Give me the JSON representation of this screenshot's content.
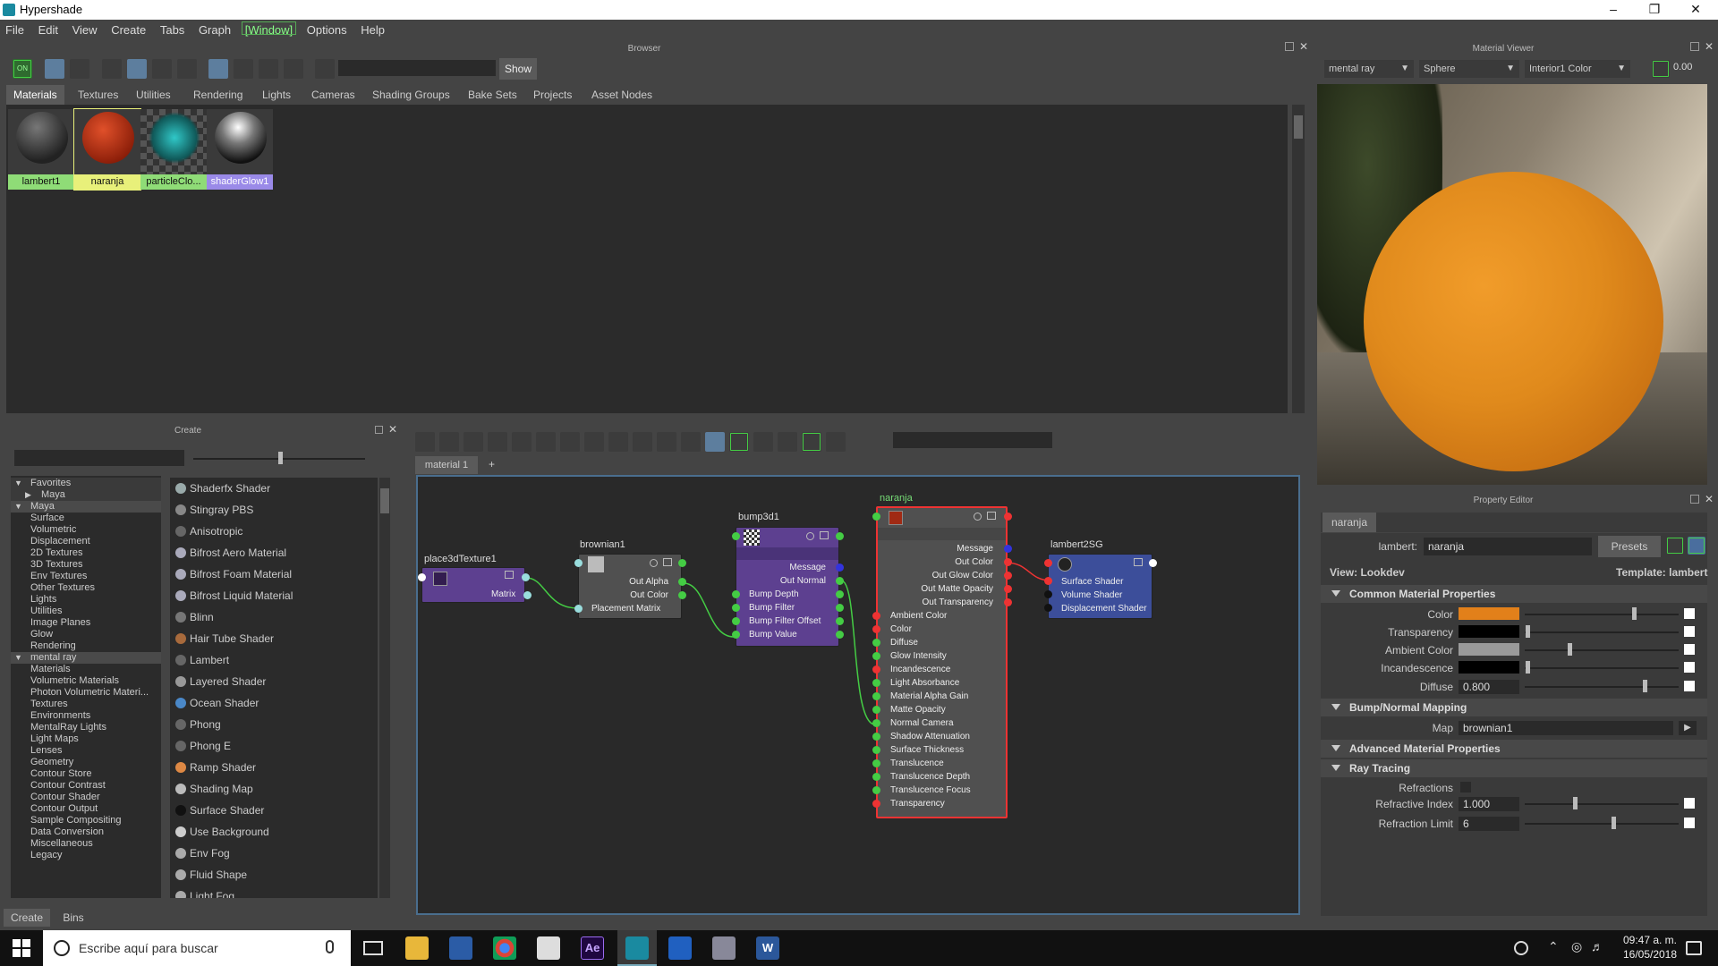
{
  "window": {
    "title": "Hypershade"
  },
  "menu": [
    "File",
    "Edit",
    "View",
    "Create",
    "Tabs",
    "Graph",
    "[Window]",
    "Options",
    "Help"
  ],
  "browser": {
    "panel_title": "Browser",
    "show_button": "Show",
    "toolbar_first": "ON",
    "tabs": [
      "Materials",
      "Textures",
      "Utilities",
      "Rendering",
      "Lights",
      "Cameras",
      "Shading Groups",
      "Bake Sets",
      "Projects",
      "Asset Nodes"
    ],
    "active_tab": "Materials",
    "swatches": [
      {
        "label": "lambert1"
      },
      {
        "label": "naranja"
      },
      {
        "label": "particleClo..."
      },
      {
        "label": "shaderGlow1"
      }
    ]
  },
  "material_viewer": {
    "panel_title": "Material Viewer",
    "renderer": "mental ray",
    "geometry": "Sphere",
    "environment": "Interior1 Color",
    "exposure": "0.00"
  },
  "create_panel": {
    "panel_title": "Create",
    "tree": [
      "Favorites",
      "Maya",
      "Maya",
      "Surface",
      "Volumetric",
      "Displacement",
      "2D Textures",
      "3D Textures",
      "Env Textures",
      "Other Textures",
      "Lights",
      "Utilities",
      "Image Planes",
      "Glow",
      "Rendering",
      "mental ray",
      "Materials",
      "Volumetric Materials",
      "Photon Volumetric Materi...",
      "Textures",
      "Environments",
      "MentalRay Lights",
      "Light Maps",
      "Lenses",
      "Geometry",
      "Contour Store",
      "Contour Contrast",
      "Contour Shader",
      "Contour Output",
      "Sample Compositing",
      "Data Conversion",
      "Miscellaneous",
      "Legacy"
    ],
    "items": [
      "Shaderfx Shader",
      "Stingray PBS",
      "Anisotropic",
      "Bifrost Aero Material",
      "Bifrost Foam Material",
      "Bifrost Liquid Material",
      "Blinn",
      "Hair Tube Shader",
      "Lambert",
      "Layered Shader",
      "Ocean Shader",
      "Phong",
      "Phong E",
      "Ramp Shader",
      "Shading Map",
      "Surface Shader",
      "Use Background",
      "Env Fog",
      "Fluid Shape",
      "Light Fog"
    ],
    "bottom_tabs": [
      "Create",
      "Bins"
    ]
  },
  "graph": {
    "tab": "material 1",
    "plus": "+",
    "nodes": {
      "place3d": {
        "name": "place3dTexture1",
        "ports": [
          "Matrix"
        ]
      },
      "brownian": {
        "name": "brownian1",
        "ports": [
          "Out Alpha",
          "Out Color",
          "Placement Matrix"
        ]
      },
      "bump": {
        "name": "bump3d1",
        "ports": [
          "Message",
          "Out Normal",
          "Bump Depth",
          "Bump Filter",
          "Bump Filter Offset",
          "Bump Value"
        ]
      },
      "naranja": {
        "name": "naranja",
        "ports": [
          "Message",
          "Out Color",
          "Out Glow Color",
          "Out Matte Opacity",
          "Out Transparency",
          "Ambient Color",
          "Color",
          "Diffuse",
          "Glow Intensity",
          "Incandescence",
          "Light Absorbance",
          "Material Alpha Gain",
          "Matte Opacity",
          "Normal Camera",
          "Shadow Attenuation",
          "Surface Thickness",
          "Translucence",
          "Translucence Depth",
          "Translucence Focus",
          "Transparency"
        ]
      },
      "sg": {
        "name": "lambert2SG",
        "ports": [
          "Surface Shader",
          "Volume Shader",
          "Displacement Shader"
        ]
      }
    }
  },
  "property_editor": {
    "panel_title": "Property Editor",
    "tab": "naranja",
    "type_label": "lambert:",
    "name_value": "naranja",
    "presets": "Presets",
    "view": "View: Lookdev",
    "template": "Template: lambert",
    "sections": [
      "Common Material Properties",
      "Bump/Normal Mapping",
      "Advanced Material Properties",
      "Ray Tracing"
    ],
    "common": [
      {
        "label": "Color",
        "swatch": "#e2801a",
        "level": 0.78
      },
      {
        "label": "Transparency",
        "swatch": "#000000",
        "level": 0.0
      },
      {
        "label": "Ambient Color",
        "swatch": "#9a9a9a",
        "level": 0.27
      },
      {
        "label": "Incandescence",
        "swatch": "#000000",
        "level": 0.0
      },
      {
        "label": "Diffuse",
        "value": "0.800",
        "level": 0.8
      }
    ],
    "bump_map": {
      "label": "Map",
      "value": "brownian1"
    },
    "raytrace": [
      {
        "label": "Refractions"
      },
      {
        "label": "Refractive Index",
        "value": "1.000",
        "level": 0.3
      },
      {
        "label": "Refraction Limit",
        "value": "6",
        "level": 0.6
      }
    ]
  },
  "taskbar": {
    "search_placeholder": "Escribe aquí para buscar",
    "time": "09:47 a. m.",
    "date": "16/05/2018",
    "ae_label": "Ae",
    "word_label": "W"
  },
  "colors": {
    "accent_green": "#44cc44",
    "selected_swatch": "#e8f07a",
    "orange": "#e2801a"
  }
}
